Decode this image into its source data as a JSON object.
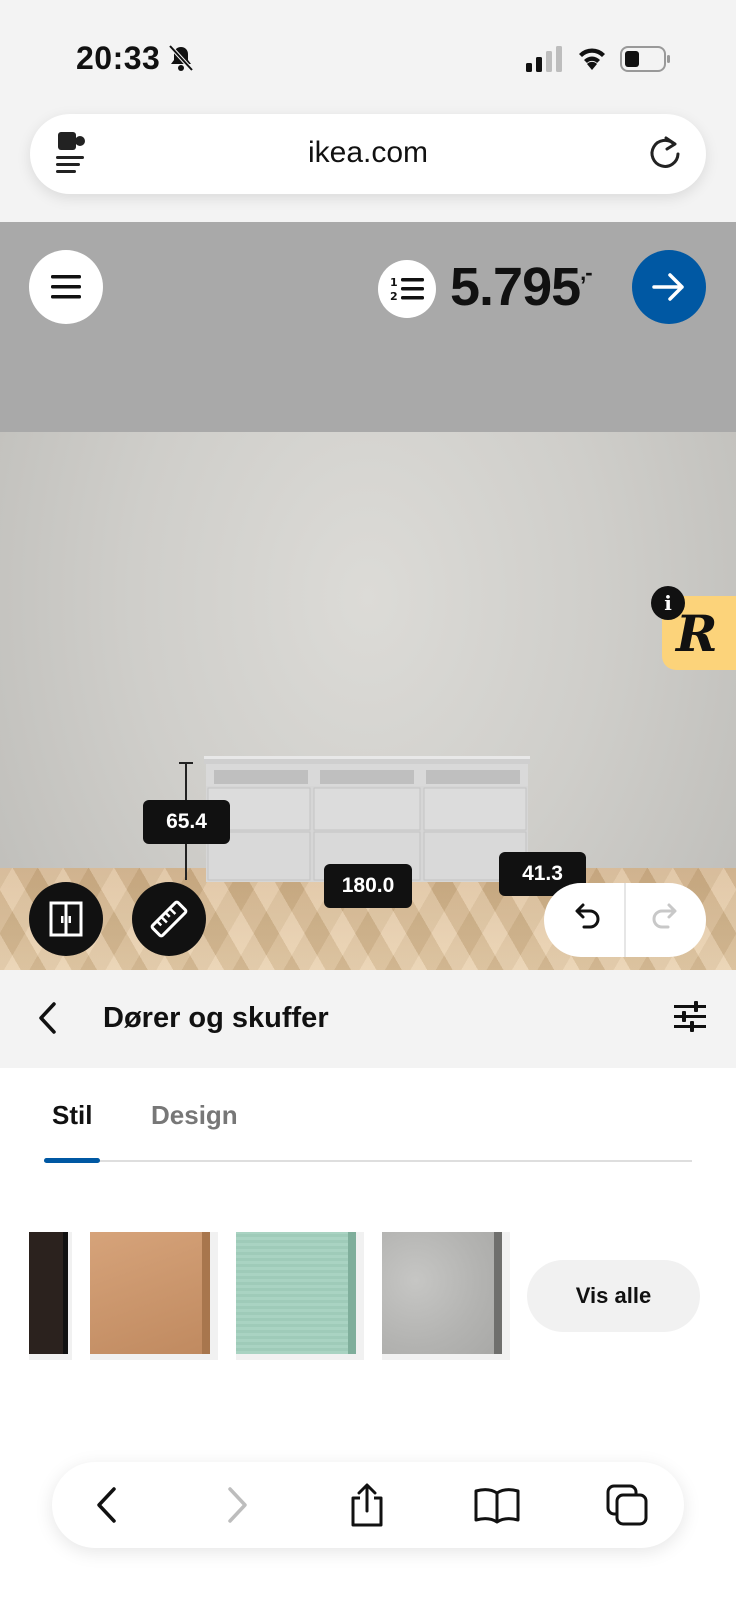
{
  "status_bar": {
    "time": "20:33",
    "icons": [
      "bell-slash-icon",
      "cellular-signal-icon",
      "wifi-icon",
      "battery-icon"
    ]
  },
  "browser": {
    "url": "ikea.com",
    "icons": [
      "extension-icon",
      "reload-icon"
    ]
  },
  "planner": {
    "price": "5.795",
    "price_suffix": ",-",
    "icons": [
      "menu-icon",
      "list-numbered-icon",
      "arrow-right-icon"
    ],
    "dimensions": {
      "height": "65.4",
      "width": "180.0",
      "depth": "41.3"
    },
    "tools": [
      "doors-view-icon",
      "ruler-icon",
      "undo-icon",
      "redo-icon",
      "info-icon"
    ],
    "accent_color": "#0058a3"
  },
  "panel": {
    "title": "Dører og skuffer",
    "tabs": [
      {
        "label": "Stil",
        "active": true
      },
      {
        "label": "Design",
        "active": false
      }
    ],
    "swatches": [
      {
        "name": "dark-brown",
        "color": "#2b221e"
      },
      {
        "name": "oak-veneer",
        "color": "#c9956b"
      },
      {
        "name": "light-green",
        "color": "#a8d1c0"
      },
      {
        "name": "concrete-grey",
        "color": "#b9b9b7"
      }
    ],
    "show_all_label": "Vis alle"
  },
  "bottom_toolbar": {
    "icons": [
      "back-icon",
      "forward-icon",
      "share-icon",
      "bookmarks-icon",
      "tabs-icon"
    ]
  }
}
